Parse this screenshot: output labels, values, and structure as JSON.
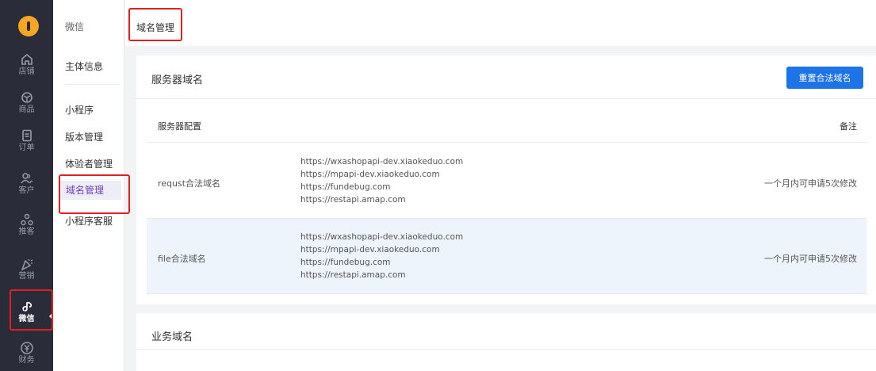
{
  "rail": {
    "items": [
      {
        "label": "店铺",
        "icon": "home-icon"
      },
      {
        "label": "商品",
        "icon": "cube-icon"
      },
      {
        "label": "订单",
        "icon": "document-icon"
      },
      {
        "label": "客户",
        "icon": "users-icon"
      },
      {
        "label": "推客",
        "icon": "share-icon"
      },
      {
        "label": "营销",
        "icon": "party-popper-icon"
      },
      {
        "label": "微信",
        "icon": "link-icon",
        "active": true
      },
      {
        "label": "财务",
        "icon": "yuan-icon"
      }
    ]
  },
  "submenu": {
    "header": "微信",
    "items": [
      "主体信息",
      "小程序",
      "版本管理",
      "体验者管理",
      "域名管理",
      "小程序客服"
    ],
    "active": "域名管理"
  },
  "breadcrumb": "域名管理",
  "server_domain": {
    "title": "服务器域名",
    "reset_button": "重置合法域名",
    "header_config": "服务器配置",
    "header_note": "备注",
    "rows": [
      {
        "name": "requst合法域名",
        "d0": "https://wxashopapi-dev.xiaokeduo.com",
        "d1": "https://mpapi-dev.xiaokeduo.com",
        "d2": "https://fundebug.com",
        "d3": "https://restapi.amap.com",
        "note": "一个月内可申请5次修改"
      },
      {
        "name": "file合法域名",
        "d0": "https://wxashopapi-dev.xiaokeduo.com",
        "d1": "https://mpapi-dev.xiaokeduo.com",
        "d2": "https://fundebug.com",
        "d3": "https://restapi.amap.com",
        "note": "一个月内可申请5次修改"
      }
    ]
  },
  "business_domain": {
    "title": "业务域名"
  },
  "colors": {
    "rail_bg": "#2b2c3a",
    "accent": "#1e73e6",
    "active_sub": "#6b3fb8",
    "highlight": "#e02020",
    "logo": "#f6a623"
  }
}
